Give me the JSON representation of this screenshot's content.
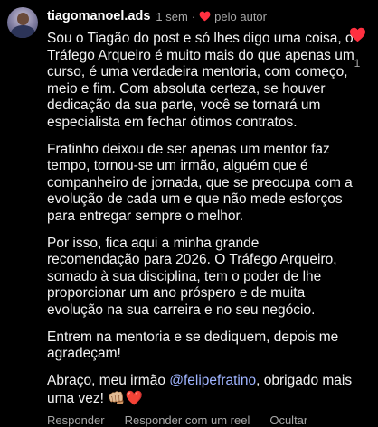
{
  "comment": {
    "username": "tiagomanoel.ads",
    "time": "1 sem",
    "separator": "·",
    "author_badge": "pelo autor",
    "like_count": "1",
    "paragraphs": [
      "Sou o Tiagão do post e só lhes digo uma coisa, o Tráfego Arqueiro é muito mais do que apenas um curso, é uma verdadeira mentoria, com começo, meio e fim. Com absoluta certeza, se houver dedicação da sua parte, você se tornará um especialista em fechar ótimos contratos.",
      "Fratinho deixou de ser apenas um mentor faz tempo, tornou-se um irmão, alguém que é companheiro de jornada, que se preocupa com a evolução de cada um e que não mede esforços para entregar sempre o melhor.",
      "Por isso, fica aqui a minha grande recomendação para 2026. O Tráfego Arqueiro, somado à sua disciplina, tem o poder de lhe proporcionar um ano próspero e de muita evolução na sua carreira e no seu negócio.",
      "Entrem na mentoria e se dediquem, depois me agradeçam!"
    ],
    "last": {
      "before": "Abraço, meu irmão ",
      "mention": "@felipefratino",
      "after": ", obrigado mais uma vez! ",
      "emoji": "👊🏼❤️"
    },
    "actions": {
      "reply": "Responder",
      "reply_reel": "Responder com um reel",
      "hide": "Ocultar"
    }
  },
  "colors": {
    "heart": "#ff3040",
    "mention": "#9fb4ff",
    "muted": "#a8a8a8",
    "background": "#000000"
  },
  "icons": {
    "like": "heart-icon",
    "author": "heart-icon"
  }
}
